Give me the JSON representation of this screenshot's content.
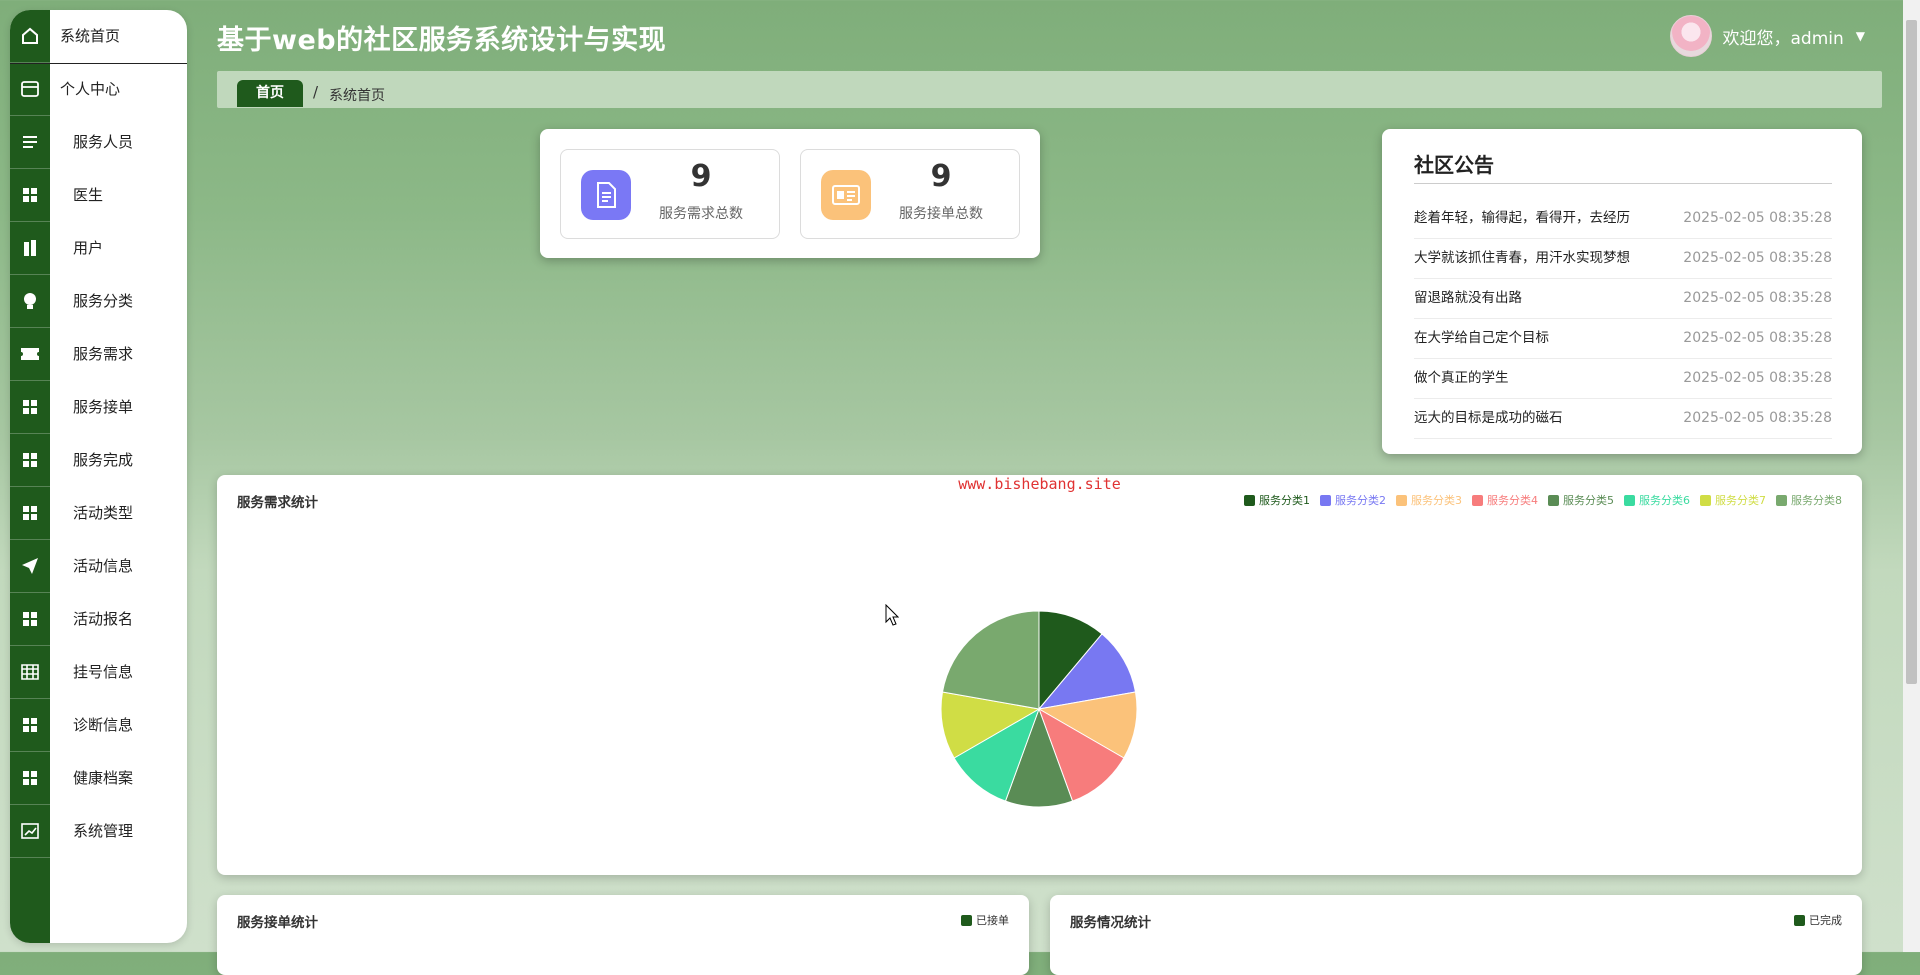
{
  "header": {
    "title": "基于web的社区服务系统设计与实现",
    "greeting": "欢迎您，admin"
  },
  "sidebar": {
    "items": [
      {
        "label": "系统首页",
        "icon": "home-icon"
      },
      {
        "label": "个人中心",
        "icon": "card-icon"
      },
      {
        "label": "服务人员",
        "icon": "list-icon"
      },
      {
        "label": "医生",
        "icon": "grid-icon"
      },
      {
        "label": "用户",
        "icon": "building-icon"
      },
      {
        "label": "服务分类",
        "icon": "bulb-icon"
      },
      {
        "label": "服务需求",
        "icon": "ticket-icon"
      },
      {
        "label": "服务接单",
        "icon": "grid-icon"
      },
      {
        "label": "服务完成",
        "icon": "grid-icon"
      },
      {
        "label": "活动类型",
        "icon": "grid-icon"
      },
      {
        "label": "活动信息",
        "icon": "send-icon"
      },
      {
        "label": "活动报名",
        "icon": "grid-icon"
      },
      {
        "label": "挂号信息",
        "icon": "table-icon"
      },
      {
        "label": "诊断信息",
        "icon": "grid-icon"
      },
      {
        "label": "健康档案",
        "icon": "grid-icon"
      },
      {
        "label": "系统管理",
        "icon": "chart-icon"
      }
    ]
  },
  "breadcrumb": {
    "home": "首页",
    "separator": "/",
    "current": "系统首页"
  },
  "stats": [
    {
      "value": "9",
      "label": "服务需求总数",
      "color": "#7a78f5"
    },
    {
      "value": "9",
      "label": "服务接单总数",
      "color": "#fbc27a"
    }
  ],
  "notice": {
    "title": "社区公告",
    "items": [
      {
        "title": "趁着年轻，输得起，看得开，去经历",
        "date": "2025-02-05 08:35:28"
      },
      {
        "title": "大学就该抓住青春，用汗水实现梦想",
        "date": "2025-02-05 08:35:28"
      },
      {
        "title": "留退路就没有出路",
        "date": "2025-02-05 08:35:28"
      },
      {
        "title": "在大学给自己定个目标",
        "date": "2025-02-05 08:35:28"
      },
      {
        "title": "做个真正的学生",
        "date": "2025-02-05 08:35:28"
      },
      {
        "title": "远大的目标是成功的磁石",
        "date": "2025-02-05 08:35:28"
      }
    ]
  },
  "watermark": "www.bishebang.site",
  "panels": {
    "demand": "服务需求统计",
    "orders": "服务接单统计",
    "status": "服务情况统计",
    "orders_legend": "已接单",
    "status_legend": "已完成"
  },
  "colors": {
    "brand": "#1f5a1c",
    "orders_legend": "#1f5a1c",
    "status_legend": "#1f5a1c"
  },
  "chart_data": {
    "type": "pie",
    "categories": [
      "服务分类1",
      "服务分类2",
      "服务分类3",
      "服务分类4",
      "服务分类5",
      "服务分类6",
      "服务分类7",
      "服务分类8"
    ],
    "values": [
      1,
      1,
      1,
      1,
      1,
      1,
      1,
      2
    ],
    "colors": [
      "#1f5a1c",
      "#7878f2",
      "#fbc27a",
      "#f77c7c",
      "#5a8c55",
      "#3adba0",
      "#d0dd45",
      "#79a96e"
    ],
    "title": "服务需求统计",
    "legend_position": "top-right"
  }
}
